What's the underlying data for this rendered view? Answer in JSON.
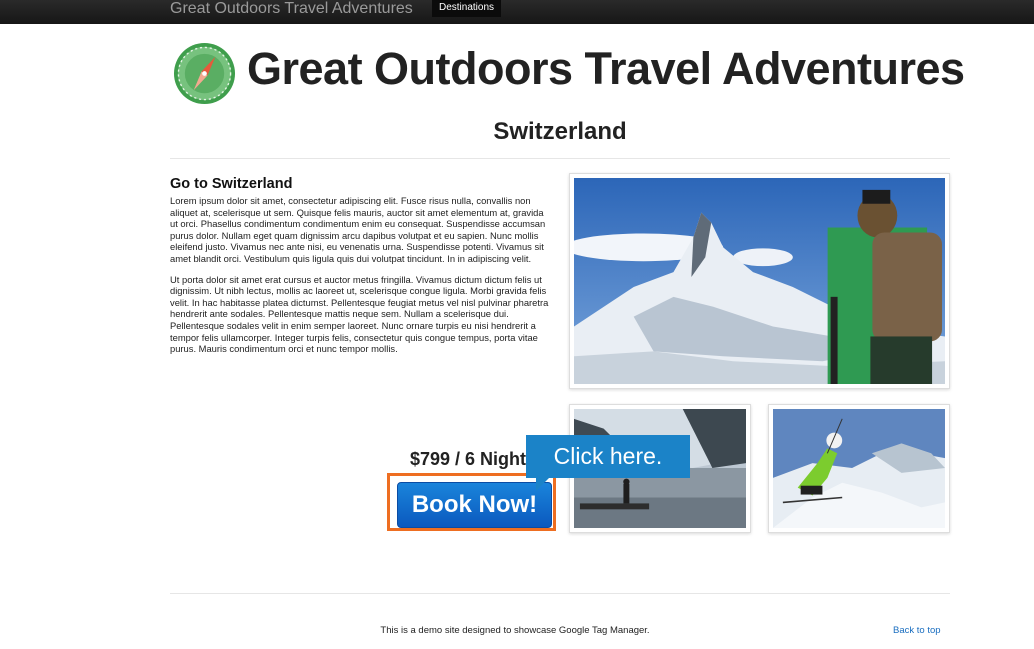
{
  "navbar": {
    "brand": "Great Outdoors Travel Adventures",
    "active_item": "Destinations"
  },
  "header": {
    "logo_icon": "compass-icon",
    "title": "Great Outdoors Travel Adventures"
  },
  "page": {
    "heading": "Switzerland"
  },
  "article": {
    "title": "Go to Switzerland",
    "paragraphs": [
      "Lorem ipsum dolor sit amet, consectetur adipiscing elit. Fusce risus nulla, convallis non aliquet at, scelerisque ut sem. Quisque felis mauris, auctor sit amet elementum at, gravida ut orci. Phasellus condimentum condimentum enim eu consequat. Suspendisse accumsan purus dolor. Nullam eget quam dignissim arcu dapibus volutpat et eu sapien. Nunc mollis eleifend justo. Vivamus nec ante nisi, eu venenatis urna. Suspendisse potenti. Vivamus sit amet blandit orci. Vestibulum quis ligula quis dui volutpat tincidunt. In in adipiscing velit.",
      "Ut porta dolor sit amet erat cursus et auctor metus fringilla. Vivamus dictum dictum felis ut dignissim. Ut nibh lectus, mollis ac laoreet ut, scelerisque congue ligula. Morbi gravida felis velit. In hac habitasse platea dictumst. Pellentesque feugiat metus vel nisl pulvinar pharetra hendrerit ante sodales. Pellentesque mattis neque sem. Nullam a scelerisque dui. Pellentesque sodales velit in enim semper laoreet. Nunc ornare turpis eu nisi hendrerit a tempor felis ullamcorper. Integer turpis felis, consectetur quis congue tempus, porta vitae purus. Mauris condimentum orci et nunc tempor mollis."
    ]
  },
  "booking": {
    "price": "$799 / 6 Nights",
    "button_label": "Book Now!"
  },
  "callout": {
    "text": "Click here."
  },
  "footer": {
    "text": "This is a demo site designed to showcase Google Tag Manager.",
    "back_to_top": "Back to top"
  },
  "colors": {
    "highlight_border": "#ee6e21",
    "callout_bg": "#1b83c8",
    "button_blue": "#0b59be",
    "link_blue": "#1a6ec0"
  }
}
